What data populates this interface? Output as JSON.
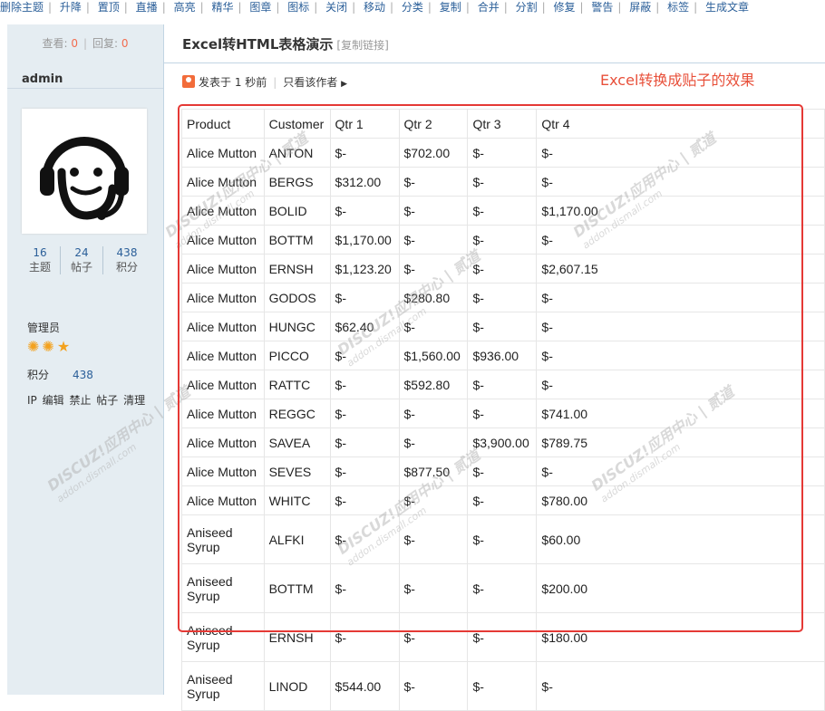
{
  "toolbar": {
    "items": [
      "删除主题",
      "升降",
      "置顶",
      "直播",
      "高亮",
      "精华",
      "图章",
      "图标",
      "关闭",
      "移动",
      "分类",
      "复制",
      "合并",
      "分割",
      "修复",
      "警告",
      "屏蔽",
      "标签",
      "生成文章"
    ]
  },
  "sidebar": {
    "views_label": "查看:",
    "views_value": "0",
    "replies_label": "回复:",
    "replies_value": "0",
    "username": "admin",
    "counts": [
      {
        "value": "16",
        "label": "主题"
      },
      {
        "value": "24",
        "label": "帖子"
      },
      {
        "value": "438",
        "label": "积分"
      }
    ],
    "role": "管理员",
    "points_label": "积分",
    "points_value": "438",
    "actions": [
      "IP",
      "编辑",
      "禁止",
      "帖子",
      "清理"
    ]
  },
  "post": {
    "title": "Excel转HTML表格演示",
    "copy_link": "[复制链接]",
    "posted": "发表于 1 秒前",
    "only_author": "只看该作者",
    "annotation": "Excel转换成贴子的效果"
  },
  "watermark": {
    "line1": "DISCUZ!应用中心 | 贰道",
    "line2": "addon.dismall.com"
  },
  "table": {
    "headers": [
      "Product",
      "Customer",
      "Qtr 1",
      "Qtr 2",
      "Qtr 3",
      "Qtr 4"
    ],
    "rows": [
      [
        "Alice Mutton",
        "ANTON",
        "$-",
        "$702.00",
        "$-",
        "$-"
      ],
      [
        "Alice Mutton",
        "BERGS",
        "$312.00",
        "$-",
        "$-",
        "$-"
      ],
      [
        "Alice Mutton",
        "BOLID",
        "$-",
        "$-",
        "$-",
        "$1,170.00"
      ],
      [
        "Alice Mutton",
        "BOTTM",
        "$1,170.00",
        "$-",
        "$-",
        "$-"
      ],
      [
        "Alice Mutton",
        "ERNSH",
        "$1,123.20",
        "$-",
        "$-",
        "$2,607.15"
      ],
      [
        "Alice Mutton",
        "GODOS",
        "$-",
        "$280.80",
        "$-",
        "$-"
      ],
      [
        "Alice Mutton",
        "HUNGC",
        "$62.40",
        "$-",
        "$-",
        "$-"
      ],
      [
        "Alice Mutton",
        "PICCO",
        "$-",
        "$1,560.00",
        "$936.00",
        "$-"
      ],
      [
        "Alice Mutton",
        "RATTC",
        "$-",
        "$592.80",
        "$-",
        "$-"
      ],
      [
        "Alice Mutton",
        "REGGC",
        "$-",
        "$-",
        "$-",
        "$741.00"
      ],
      [
        "Alice Mutton",
        "SAVEA",
        "$-",
        "$-",
        "$3,900.00",
        "$789.75"
      ],
      [
        "Alice Mutton",
        "SEVES",
        "$-",
        "$877.50",
        "$-",
        "$-"
      ],
      [
        "Alice Mutton",
        "WHITC",
        "$-",
        "$-",
        "$-",
        "$780.00"
      ],
      [
        "Aniseed Syrup",
        "ALFKI",
        "$-",
        "$-",
        "$-",
        "$60.00"
      ],
      [
        "Aniseed Syrup",
        "BOTTM",
        "$-",
        "$-",
        "$-",
        "$200.00"
      ],
      [
        "Aniseed Syrup",
        "ERNSH",
        "$-",
        "$-",
        "$-",
        "$180.00"
      ],
      [
        "Aniseed Syrup",
        "LINOD",
        "$544.00",
        "$-",
        "$-",
        "$-"
      ]
    ]
  },
  "colors": {
    "link": "#2b5f99",
    "sidebar_bg": "#e5edf2",
    "highlight": "#e53935",
    "count_accent": "#f26c4f"
  }
}
